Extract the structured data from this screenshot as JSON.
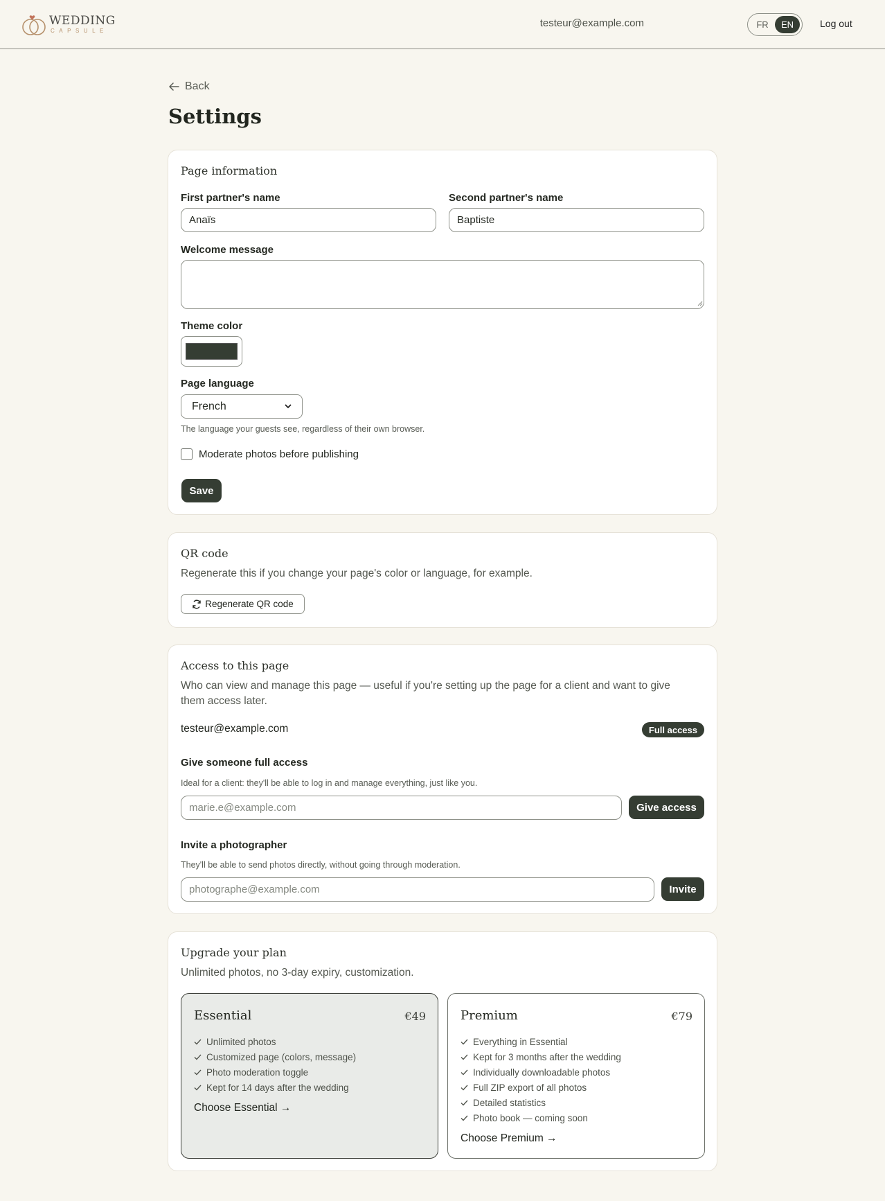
{
  "header": {
    "logo_title": "WEDDING",
    "logo_subtitle": "CAPSULE",
    "user_email": "testeur@example.com",
    "lang_fr": "FR",
    "lang_en": "EN",
    "logout": "Log out"
  },
  "page": {
    "back": "Back",
    "title": "Settings"
  },
  "page_info": {
    "title": "Page information",
    "first_partner_label": "First partner's name",
    "first_partner_value": "Anaïs",
    "second_partner_label": "Second partner's name",
    "second_partner_value": "Baptiste",
    "welcome_label": "Welcome message",
    "welcome_value": "",
    "theme_label": "Theme color",
    "theme_color": "#353d33",
    "language_label": "Page language",
    "language_value": "French",
    "language_help": "The language your guests see, regardless of their own browser.",
    "moderate_label": "Moderate photos before publishing",
    "save": "Save"
  },
  "qr": {
    "title": "QR code",
    "desc": "Regenerate this if you change your page's color or language, for example.",
    "button": "Regenerate QR code"
  },
  "access": {
    "title": "Access to this page",
    "desc": "Who can view and manage this page — useful if you're setting up the page for a client and want to give them access later.",
    "owner_email": "testeur@example.com",
    "owner_badge": "Full access",
    "full_title": "Give someone full access",
    "full_help": "Ideal for a client: they'll be able to log in and manage everything, just like you.",
    "full_placeholder": "marie.e@example.com",
    "full_button": "Give access",
    "photographer_title": "Invite a photographer",
    "photographer_help": "They'll be able to send photos directly, without going through moderation.",
    "photographer_placeholder": "photographe@example.com",
    "photographer_button": "Invite"
  },
  "upgrade": {
    "title": "Upgrade your plan",
    "desc": "Unlimited photos, no 3-day expiry, customization.",
    "plans": [
      {
        "name": "Essential",
        "price": "€49",
        "features": [
          "Unlimited photos",
          "Customized page (colors, message)",
          "Photo moderation toggle",
          "Kept for 14 days after the wedding"
        ],
        "cta": "Choose Essential →"
      },
      {
        "name": "Premium",
        "price": "€79",
        "features": [
          "Everything in Essential",
          "Kept for 3 months after the wedding",
          "Individually downloadable photos",
          "Full ZIP export of all photos",
          "Detailed statistics",
          "Photo book — coming soon"
        ],
        "cta": "Choose Premium →"
      }
    ]
  }
}
